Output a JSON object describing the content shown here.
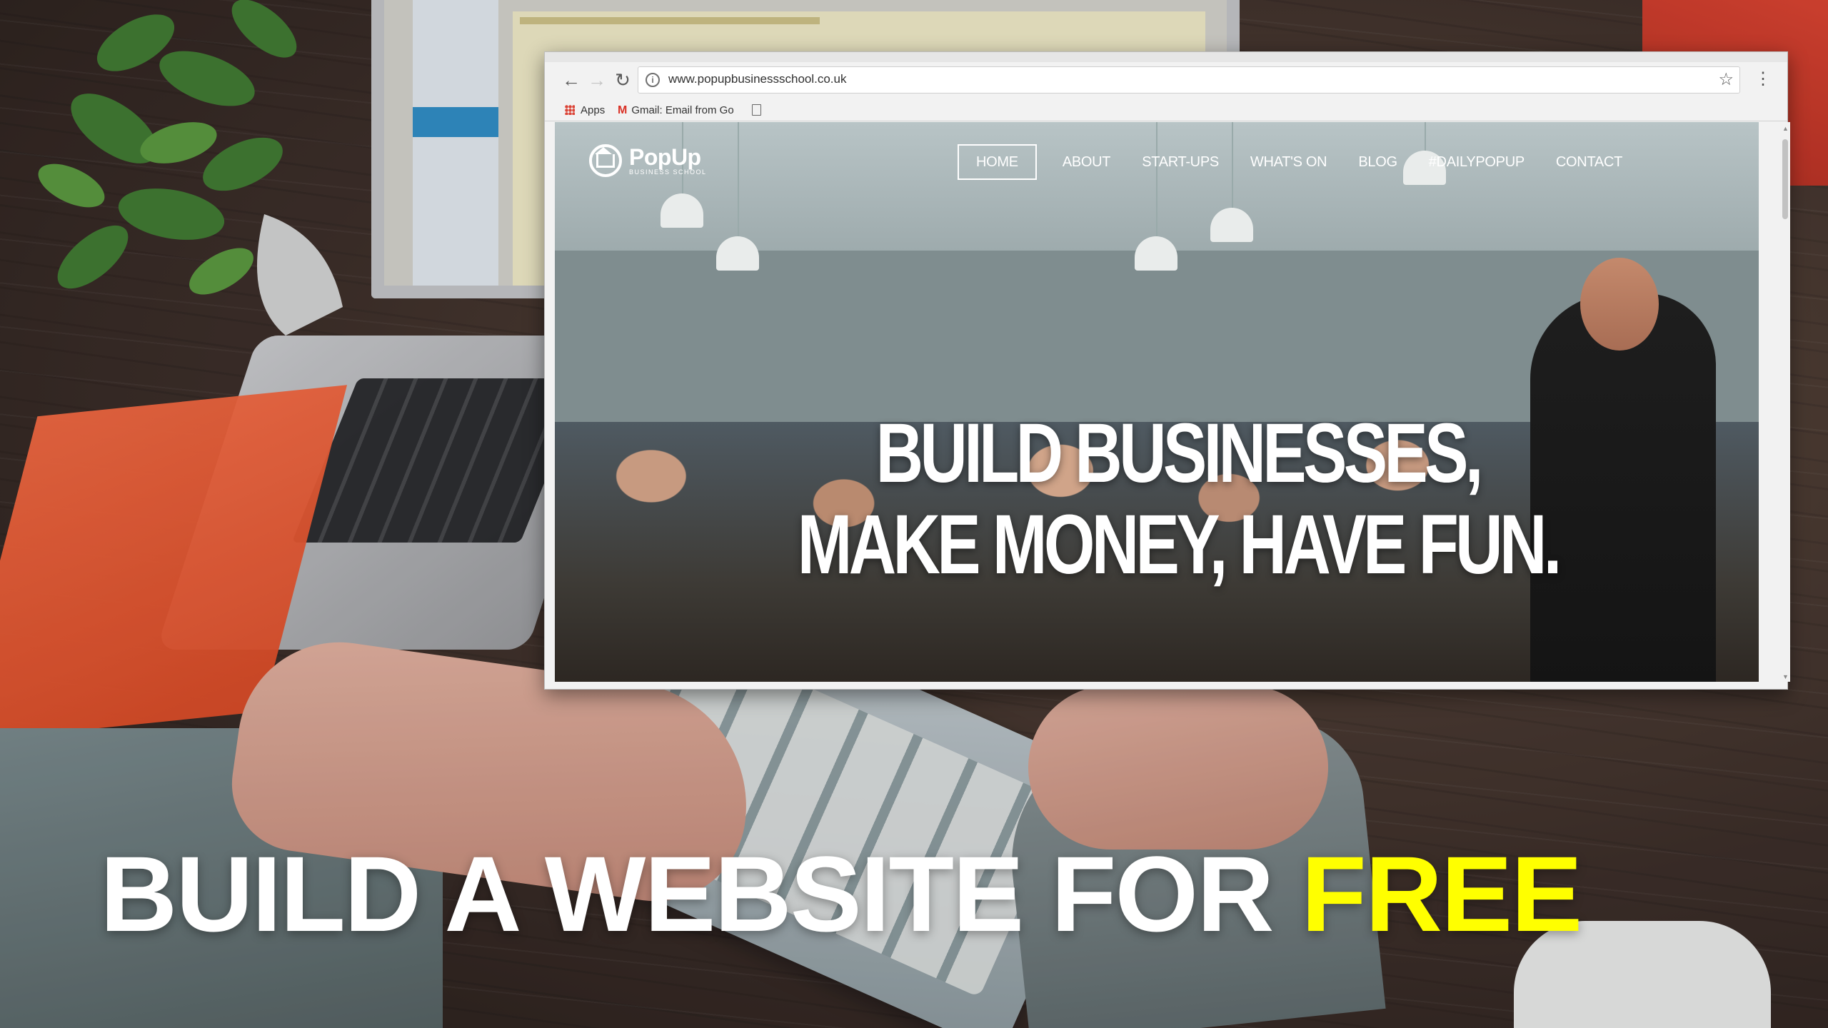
{
  "browser": {
    "url": "www.popupbusinessschool.co.uk",
    "bookmarks": {
      "apps": "Apps",
      "gmail": "Gmail: Email from Go"
    }
  },
  "website": {
    "logo": {
      "name": "PopUp",
      "subtitle": "BUSINESS SCHOOL"
    },
    "nav": [
      "HOME",
      "ABOUT",
      "START-UPS",
      "WHAT'S ON",
      "BLOG",
      "#DAILYPOPUP",
      "CONTACT"
    ],
    "active_nav": "HOME",
    "hero": {
      "line1": "BUILD BUSINESSES,",
      "line2": "MAKE MONEY, HAVE FUN."
    }
  },
  "caption": {
    "main": "BUILD A WEBSITE FOR ",
    "highlight": "FREE"
  },
  "colors": {
    "highlight": "#ffff00",
    "caption": "#ffffff"
  }
}
